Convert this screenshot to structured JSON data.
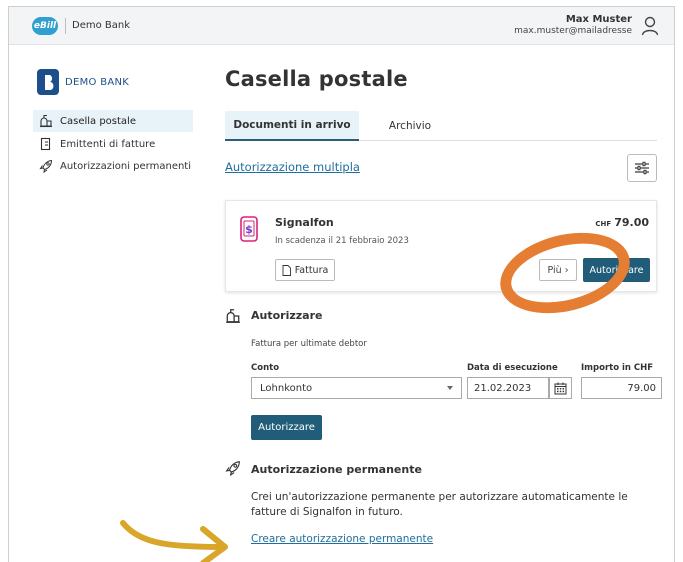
{
  "topbar": {
    "logo_text": "eBill",
    "bank_name": "Demo Bank",
    "user_name": "Max Muster",
    "user_email": "max.muster@mailadresse"
  },
  "sidebar": {
    "logo_text": "DEMO BANK",
    "items": [
      {
        "label": "Casella postale",
        "icon": "mailbox-icon",
        "active": true
      },
      {
        "label": "Emittenti di fatture",
        "icon": "document-icon",
        "active": false
      },
      {
        "label": "Autorizzazioni permanenti",
        "icon": "rocket-icon",
        "active": false
      }
    ]
  },
  "main": {
    "title": "Casella postale",
    "tabs": [
      {
        "label": "Documenti in arrivo",
        "active": true
      },
      {
        "label": "Archivio",
        "active": false
      }
    ],
    "multi_auth_link": "Autorizzazione multipla",
    "bill": {
      "biller": "Signalfon",
      "due": "In scadenza il 21 febbraio 2023",
      "currency": "CHF",
      "amount": "79.00",
      "invoice_button": "Fattura",
      "more_button": "Più ›",
      "authorize_button": "Autorizzare"
    },
    "authorize": {
      "title": "Autorizzare",
      "subtitle": "Fattura per ultimate debtor",
      "account_label": "Conto",
      "account_value": "Lohnkonto",
      "date_label": "Data di esecuzione",
      "date_value": "21.02.2023",
      "amount_label": "Importo in CHF",
      "amount_value": "79.00",
      "submit_button": "Autorizzare"
    },
    "permanent": {
      "title": "Autorizzazione permanente",
      "text": "Crei un'autorizzazione permanente per autorizzare automaticamente le fatture di Signalfon in futuro.",
      "link": "Creare autorizzazione permanente"
    }
  },
  "colors": {
    "accent": "#215d79",
    "link": "#1e6e9e",
    "highlight_ring": "#e57d33",
    "highlight_arrow": "#d9a62a",
    "ebill": "#2f9fd0"
  }
}
